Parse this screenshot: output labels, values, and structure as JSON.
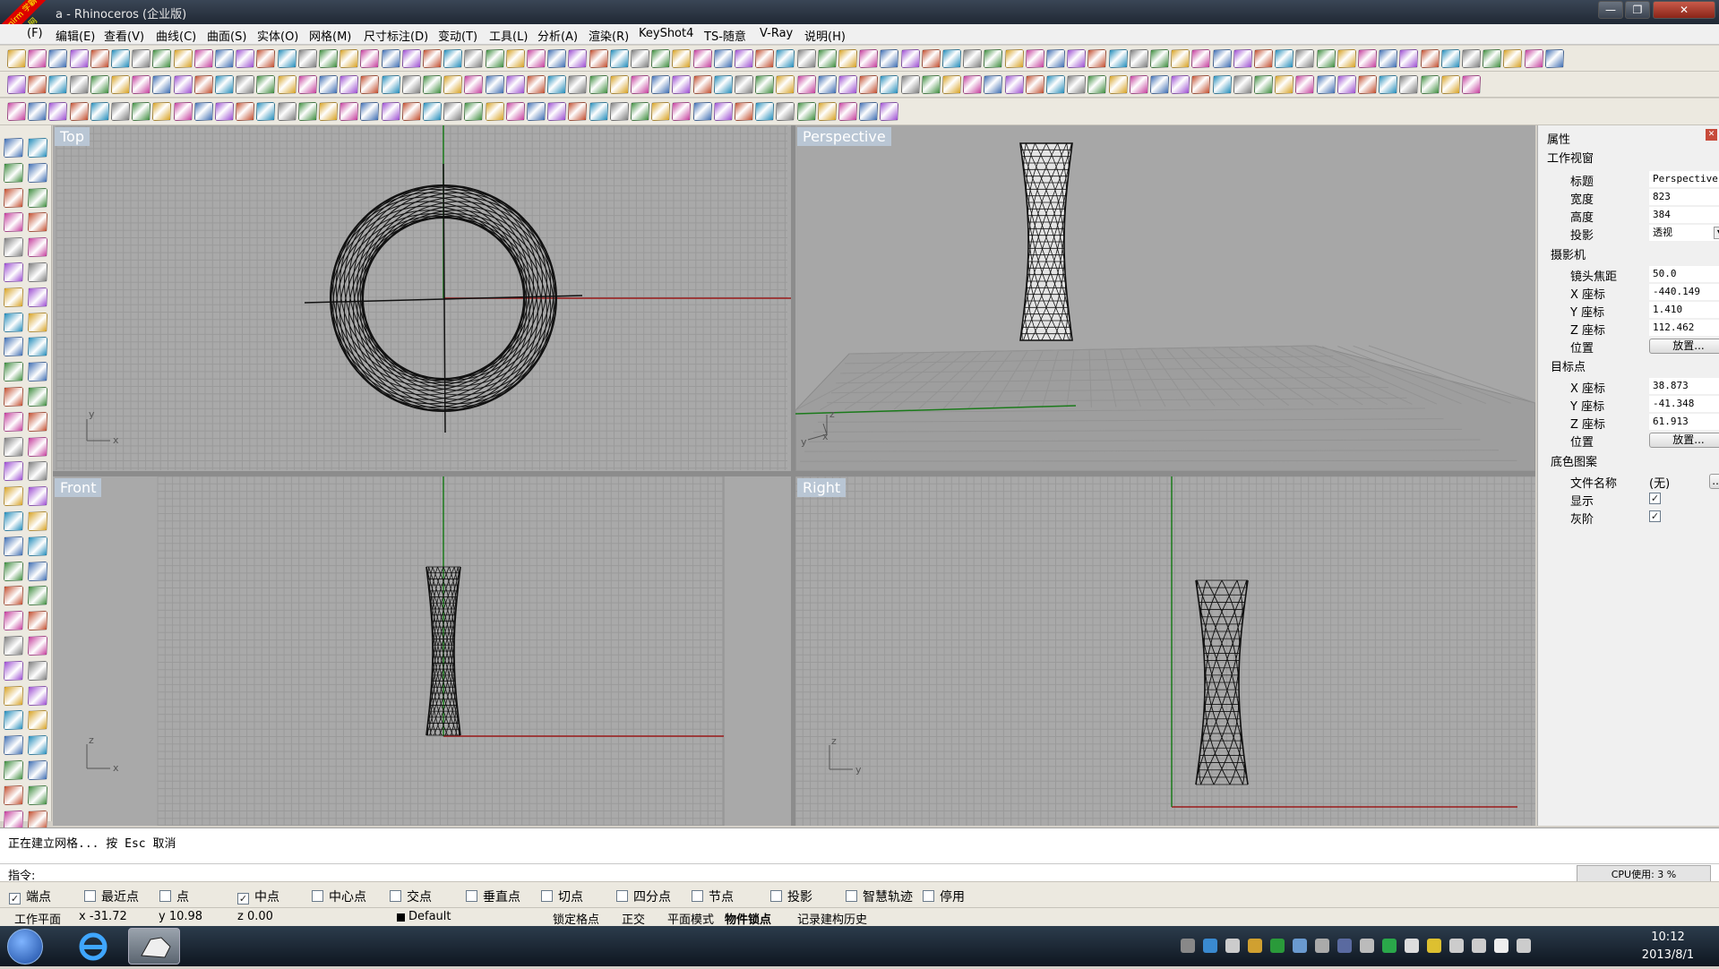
{
  "window": {
    "title": "a - Rhinoceros (企业版)",
    "badge": "xuenirm 学霸中文网"
  },
  "menu": [
    "(F)",
    "编辑(E)",
    "查看(V)",
    "曲线(C)",
    "曲面(S)",
    "实体(O)",
    "网格(M)",
    "尺寸标注(D)",
    "变动(T)",
    "工具(L)",
    "分析(A)",
    "渲染(R)",
    "KeyShot4",
    "TS-随意",
    "V-Ray",
    "说明(H)"
  ],
  "viewports": [
    {
      "name": "Top",
      "label": "Top"
    },
    {
      "name": "Perspective",
      "label": "Perspective"
    },
    {
      "name": "Front",
      "label": "Front"
    },
    {
      "name": "Right",
      "label": "Right"
    }
  ],
  "axes": {
    "top": [
      "y",
      "x"
    ],
    "persp": [
      "z",
      "y",
      "x"
    ],
    "front": [
      "z",
      "x"
    ],
    "right": [
      "z",
      "y"
    ]
  },
  "properties": {
    "panel_title": "属性",
    "section_viewport": "工作视窗",
    "title_label": "标题",
    "title_value": "Perspective",
    "width_label": "宽度",
    "width_value": "823",
    "height_label": "高度",
    "height_value": "384",
    "projection_label": "投影",
    "projection_value": "透视",
    "section_camera": "摄影机",
    "lens_label": "镜头焦距",
    "lens_value": "50.0",
    "cam_x_label": "X 座标",
    "cam_x_value": "-440.149",
    "cam_y_label": "Y 座标",
    "cam_y_value": "1.410",
    "cam_z_label": "Z 座标",
    "cam_z_value": "112.462",
    "cam_pos_label": "位置",
    "place_btn": "放置...",
    "section_target": "目标点",
    "tgt_x_label": "X 座标",
    "tgt_x_value": "38.873",
    "tgt_y_label": "Y 座标",
    "tgt_y_value": "-41.348",
    "tgt_z_label": "Z 座标",
    "tgt_z_value": "61.913",
    "tgt_pos_label": "位置",
    "section_wallpaper": "底色图案",
    "file_label": "文件名称",
    "file_value": "(无)",
    "file_btn": "...",
    "show_label": "显示",
    "gray_label": "灰阶"
  },
  "command": {
    "history": "正在建立网格... 按 Esc 取消",
    "prompt": "指令:",
    "cpu": "CPU使用: 3 %"
  },
  "osnaps": [
    {
      "label": "端点",
      "checked": true
    },
    {
      "label": "最近点",
      "checked": false
    },
    {
      "label": "点",
      "checked": false
    },
    {
      "label": "中点",
      "checked": true
    },
    {
      "label": "中心点",
      "checked": false
    },
    {
      "label": "交点",
      "checked": false
    },
    {
      "label": "垂直点",
      "checked": false
    },
    {
      "label": "切点",
      "checked": false
    },
    {
      "label": "四分点",
      "checked": false
    },
    {
      "label": "节点",
      "checked": false
    },
    {
      "label": "投影",
      "checked": false
    },
    {
      "label": "智慧轨迹",
      "checked": false
    },
    {
      "label": "停用",
      "checked": false
    }
  ],
  "status": {
    "cplane": "工作平面",
    "x": "x -31.72",
    "y": "y 10.98",
    "z": "z 0.00",
    "layer": "Default",
    "grid_snap": "锁定格点",
    "ortho": "正交",
    "planar": "平面模式",
    "osnap": "物件锁点",
    "history": "记录建构历史"
  },
  "taskbar": {
    "time": "10:12",
    "date": "2013/8/1"
  },
  "icons": [
    "windows-start-icon",
    "internet-explorer-icon",
    "rhino-app-icon"
  ]
}
